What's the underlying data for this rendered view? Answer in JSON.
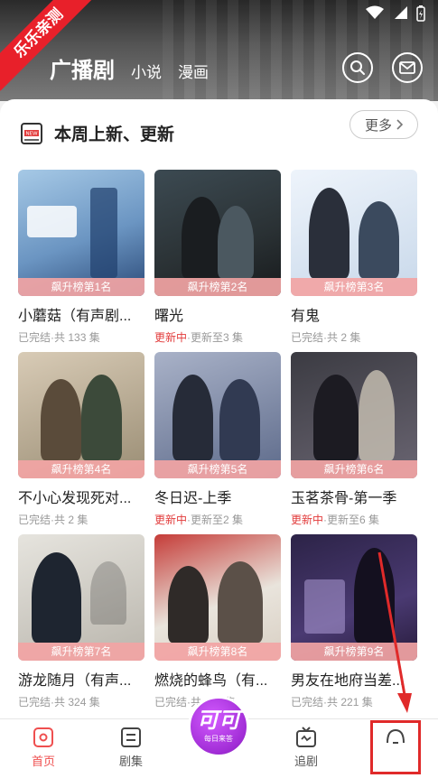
{
  "status_bar": {
    "wifi_icon": "wifi-icon",
    "signal_icon": "signal-icon",
    "battery_icon": "battery-icon"
  },
  "watermark": "乐乐亲测",
  "header": {
    "tabs": [
      {
        "label": "广播剧",
        "active": true
      },
      {
        "label": "小说",
        "active": false
      },
      {
        "label": "漫画",
        "active": false
      }
    ],
    "search_icon": "search-icon",
    "message_icon": "message-icon"
  },
  "section": {
    "icon": "new-badge-icon",
    "title": "本周上新、更新",
    "more_label": "更多"
  },
  "items": [
    {
      "badge": "飙升榜第1名",
      "title": "小蘑菇（有声剧...",
      "status": "已完结",
      "info": "·共 133 集"
    },
    {
      "badge": "飙升榜第2名",
      "title": "曙光",
      "status": "更新中",
      "info": "·更新至3 集"
    },
    {
      "badge": "飙升榜第3名",
      "title": "有鬼",
      "status": "已完结",
      "info": "·共 2 集"
    },
    {
      "badge": "飙升榜第4名",
      "title": "不小心发现死对...",
      "status": "已完结",
      "info": "·共 2 集"
    },
    {
      "badge": "飙升榜第5名",
      "title": "冬日迟-上季",
      "status": "更新中",
      "info": "·更新至2 集"
    },
    {
      "badge": "飙升榜第6名",
      "title": "玉茗茶骨-第一季",
      "status": "更新中",
      "info": "·更新至6 集"
    },
    {
      "badge": "飙升榜第7名",
      "title": "游龙随月（有声...",
      "status": "已完结",
      "info": "·共 324 集"
    },
    {
      "badge": "飙升榜第8名",
      "title": "燃烧的蜂鸟（有...",
      "status": "已完结",
      "info": "·共 110 集"
    },
    {
      "badge": "飙升榜第9名",
      "title": "男友在地府当差...",
      "status": "已完结",
      "info": "·共 221 集"
    }
  ],
  "bottom_nav": {
    "items": [
      {
        "label": "首页",
        "icon": "home-icon",
        "active": true
      },
      {
        "label": "剧集",
        "icon": "drama-list-icon",
        "active": false
      },
      {
        "label": "追剧",
        "icon": "tv-icon",
        "active": false
      },
      {
        "label": "",
        "icon": "profile-icon",
        "active": false
      }
    ],
    "center": {
      "main": "可可",
      "sub": "每日来答"
    }
  },
  "colors": {
    "accent": "#ef4f4f",
    "updating": "#e23b3b",
    "badge_bg": "#f2a4a4",
    "center_button": "#a12dd6",
    "annotation": "#e02a2a"
  }
}
